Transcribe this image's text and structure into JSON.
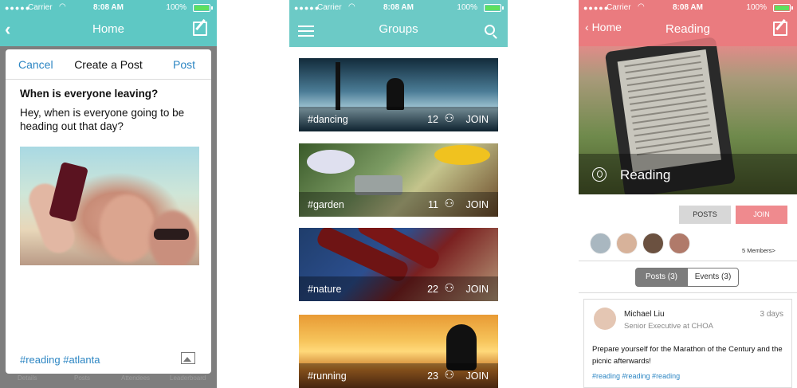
{
  "status_bar": {
    "signal": "●●●●●",
    "carrier": "Carrier",
    "time": "8:08 AM",
    "battery": "100%"
  },
  "screen_home": {
    "nav_title": "Home",
    "back_icon": "chevron-left-icon",
    "compose_icon": "compose-icon",
    "modal": {
      "cancel": "Cancel",
      "title": "Create a Post",
      "post": "Post",
      "post_title": "When is everyone leaving?",
      "post_body": "Hey, when is everyone going to be heading out that day?",
      "hashtags": "#reading #atlanta",
      "image_icon": "image-icon"
    },
    "tabbar": [
      "Details",
      "Posts",
      "Attendees",
      "Leaderboard"
    ]
  },
  "screen_groups": {
    "nav_title": "Groups",
    "menu_icon": "hamburger-icon",
    "search_icon": "search-icon",
    "groups": [
      {
        "tag": "#dancing",
        "count": "12",
        "action": "JOIN"
      },
      {
        "tag": "#garden",
        "count": "11",
        "action": "JOIN"
      },
      {
        "tag": "#nature",
        "count": "22",
        "action": "JOIN"
      },
      {
        "tag": "#running",
        "count": "23",
        "action": "JOIN"
      }
    ]
  },
  "screen_reading": {
    "back_label": "Home",
    "nav_title": "Reading",
    "group_name": "Reading",
    "btn_posts": "POSTS",
    "btn_join": "JOIN",
    "members_link": "5 Members>",
    "tabs": {
      "posts": "Posts (3)",
      "events": "Events (3)"
    },
    "post": {
      "author": "Michael Liu",
      "role": "Senior Executive at CHOA",
      "time": "3 days",
      "text": "Prepare yourself for the Marathon of the Century and the picnic afterwards!",
      "hashtags": "#reading #reading #reading"
    }
  },
  "colors": {
    "teal": "#5ec8c4",
    "coral": "#ef8a8e",
    "link_blue": "#2d86c3"
  }
}
